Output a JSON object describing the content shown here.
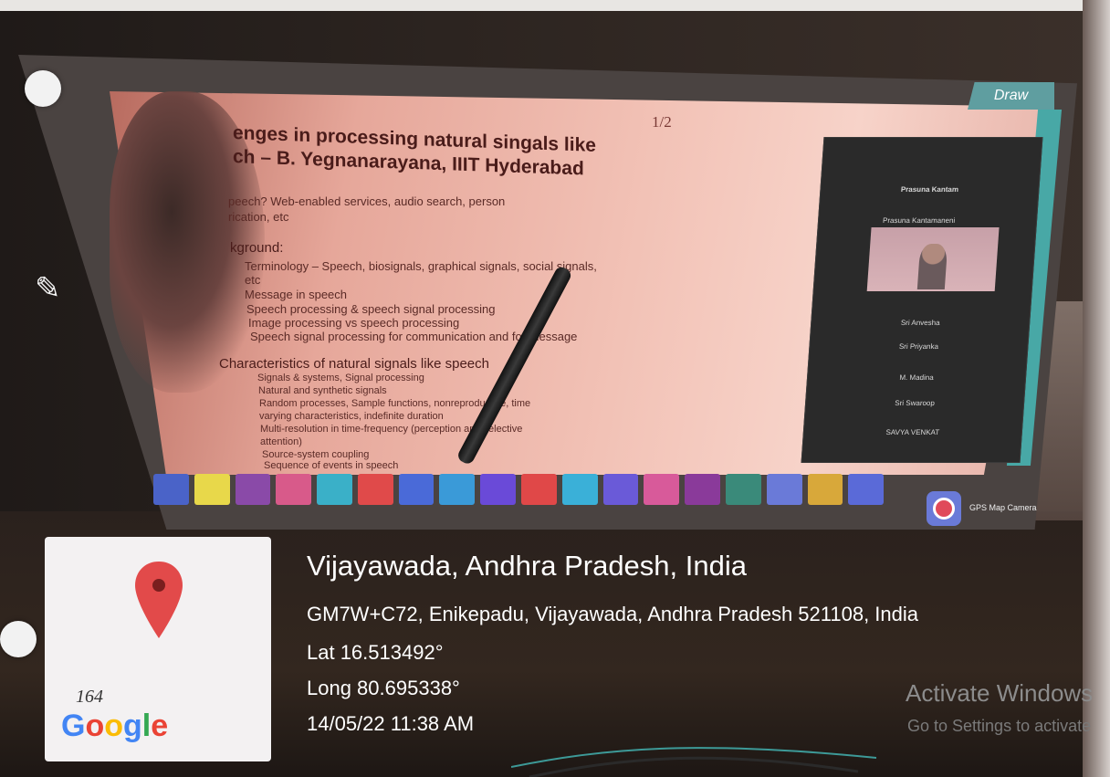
{
  "slide": {
    "page_mark": "1/2",
    "title_line1": "enges in processing natural singals like",
    "title_line2": "ch – B. Yegnanarayana, IIIT Hyderabad",
    "intro_line1": "peech? Web-enabled services, audio search, person",
    "intro_line2": "rication, etc",
    "background_head": "kground:",
    "bullets_a": [
      "Terminology – Speech, biosignals, graphical signals, social signals,",
      "etc",
      "Message in speech",
      "Speech processing & speech signal processing",
      "Image processing vs speech processing",
      "Speech signal processing for communication and for message"
    ],
    "characteristics_head": "Characteristics of natural signals like speech",
    "bullets_b": [
      "Signals & systems, Signal processing",
      "Natural and synthetic signals",
      "Random processes, Sample functions, nonreproducible, time",
      "varying characteristics, indefinite duration",
      "Multi-resolution in time-frequency (perception and selective",
      "attention)",
      "Source-system coupling",
      "Sequence of events in speech"
    ]
  },
  "toolbar": {
    "draw_label": "Draw"
  },
  "participants": {
    "header_name": "Prasuna Kantam",
    "camera_label": "Prasuna Kantamaneni",
    "list": [
      "Sri Anvesha",
      "Sri Priyanka",
      "M. Madina",
      "Sri Swaroop",
      "SAVYA VENKAT"
    ]
  },
  "gps_app": {
    "label": "GPS Map Camera"
  },
  "location": {
    "title": "Vijayawada, Andhra Pradesh, India",
    "address": "GM7W+C72, Enikepadu, Vijayawada, Andhra Pradesh 521108, India",
    "lat": "Lat 16.513492°",
    "long": "Long 80.695338°",
    "datetime": "14/05/22 11:38 AM"
  },
  "map_card": {
    "handwritten_number": "164",
    "logo_text": "Google"
  },
  "watermark": {
    "line1": "Activate Windows",
    "line2": "Go to Settings to activate"
  },
  "colors": {
    "draw_button": "#5f9ea0",
    "pin": "#e24a4a",
    "google": [
      "#4285F4",
      "#EA4335",
      "#FBBC05",
      "#4285F4",
      "#34A853",
      "#EA4335"
    ]
  },
  "taskbar_icons": [
    "monitor-icon",
    "webcam-icon",
    "app-icon",
    "camera-icon",
    "star-icon",
    "grid-icon",
    "window-icon",
    "folder-icon",
    "mail-icon",
    "record-icon",
    "link-icon",
    "people-icon",
    "search-icon",
    "app2-icon",
    "chrome-icon",
    "app3-icon",
    "settings-icon",
    "app4-icon"
  ],
  "taskbar_colors": [
    "#4a63c8",
    "#e8d84a",
    "#8a4aa8",
    "#d85a8a",
    "#3ab0c8",
    "#e04a4a",
    "#4a6ad8",
    "#3a9ad8",
    "#6a4ad8",
    "#e04848",
    "#3ab0d8",
    "#6a5ad8",
    "#d85a9a",
    "#8a3a9a",
    "#3a8a7a",
    "#6a7ad8",
    "#d8a83a",
    "#5a6ad8"
  ]
}
